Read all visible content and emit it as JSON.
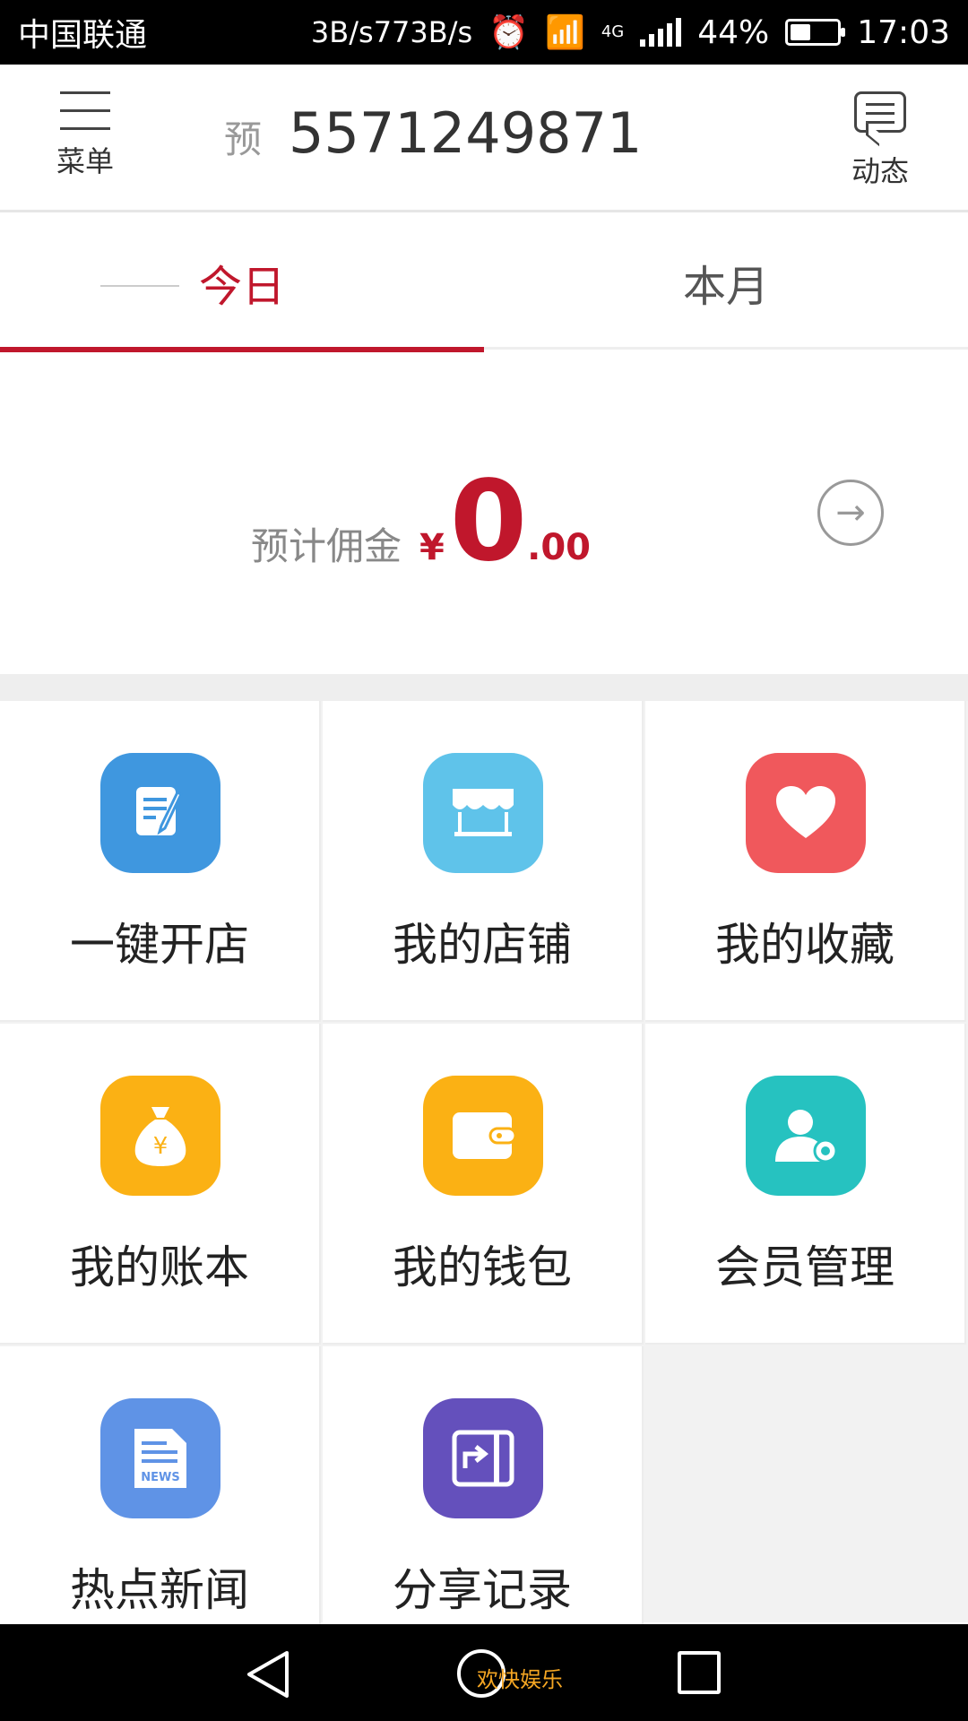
{
  "status_bar": {
    "carrier": "中国联通",
    "network_speed": "3B/s773B/s",
    "network_type": "4G",
    "battery": "44%",
    "battery_level": 0.44,
    "time": "17:03"
  },
  "header": {
    "menu_label": "菜单",
    "title_prefix": "预",
    "title_number": "5571249871",
    "dynamic_label": "动态"
  },
  "tabs": [
    {
      "label": "今日",
      "active": true
    },
    {
      "label": "本月",
      "active": false
    }
  ],
  "commission": {
    "label": "预计佣金",
    "currency": "¥",
    "integer": "0",
    "decimal": ".00"
  },
  "grid": [
    {
      "label": "一键开店",
      "icon": "note-pen-icon",
      "color": "#3f97df"
    },
    {
      "label": "我的店铺",
      "icon": "storefront-icon",
      "color": "#5fc3ea"
    },
    {
      "label": "我的收藏",
      "icon": "heart-icon",
      "color": "#f0585c"
    },
    {
      "label": "我的账本",
      "icon": "money-bag-icon",
      "color": "#fbb114"
    },
    {
      "label": "我的钱包",
      "icon": "wallet-icon",
      "color": "#fbb114"
    },
    {
      "label": "会员管理",
      "icon": "member-settings-icon",
      "color": "#26c2c0"
    },
    {
      "label": "热点新闻",
      "icon": "news-icon",
      "color": "#5f93e6"
    },
    {
      "label": "分享记录",
      "icon": "share-icon",
      "color": "#6450bc"
    }
  ],
  "nav_watermark": "欢快娱乐"
}
